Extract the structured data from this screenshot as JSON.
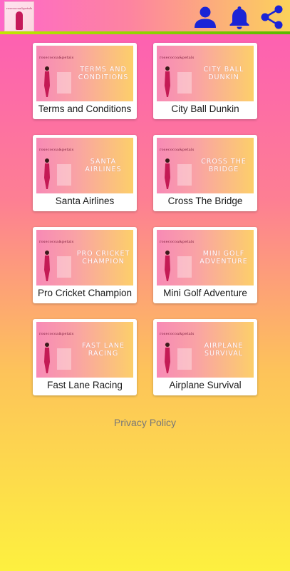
{
  "header": {
    "logo_brand": "rosecocoa&petals",
    "logo_tag": "",
    "icons": {
      "profile": "person-icon",
      "notifications": "bell-icon",
      "share": "share-icon"
    },
    "icon_color": "#1a24d6"
  },
  "thumbnail_brand": "rosecocoa&petals",
  "games": [
    {
      "title": "TERMS AND CONDITIONS",
      "label": "Terms and Conditions"
    },
    {
      "title": "CITY BALL DUNKIN",
      "label": "City Ball Dunkin"
    },
    {
      "title": "SANTA AIRLINES",
      "label": "Santa Airlines"
    },
    {
      "title": "CROSS THE BRIDGE",
      "label": "Cross The Bridge"
    },
    {
      "title": "PRO CRICKET CHAMPION",
      "label": "Pro Cricket Champion"
    },
    {
      "title": "MINI GOLF ADVENTURE",
      "label": "Mini Golf Adventure"
    },
    {
      "title": "FAST LANE RACING",
      "label": "Fast Lane Racing"
    },
    {
      "title": "AIRPLANE SURVIVAL",
      "label": "Airplane Survival"
    }
  ],
  "footer": {
    "privacy_label": "Privacy Policy"
  }
}
